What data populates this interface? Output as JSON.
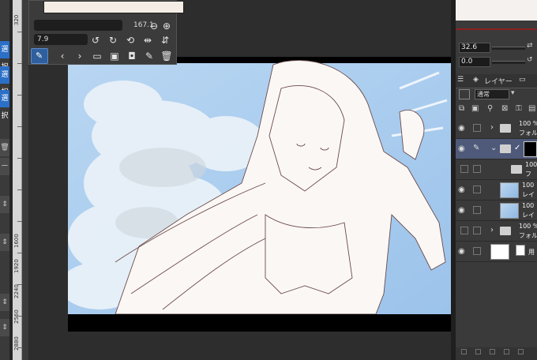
{
  "left_tabs": [
    "選択",
    "選択",
    "選択"
  ],
  "left_misc": {
    "label_a": "ー"
  },
  "ruler_marks": [
    "320",
    "1600",
    "1920",
    "2240",
    "2560",
    "2880"
  ],
  "navigator": {
    "zoom_value": "167.1",
    "rotate_value": "7.9",
    "icons": [
      "minus-icon",
      "plus-icon",
      "fit-icon",
      "rotate-left-icon",
      "rotate-right-icon",
      "reset-rotation-icon",
      "flip-horizontal-icon",
      "flip-vertical-icon",
      "eyedropper-icon",
      "prev-icon",
      "next-icon",
      "folder-open-icon",
      "new-image-icon",
      "camera-icon",
      "edit-icon",
      "trash-icon"
    ]
  },
  "right_panel": {
    "brush_size_value": "32.6",
    "opacity_value": "0.0",
    "layer_tab_label": "レイヤー",
    "blend_mode": "通常",
    "layers": [
      {
        "pct": "100 %",
        "name": "フォル",
        "kind": "folder",
        "selected": false
      },
      {
        "pct": "",
        "name": "",
        "kind": "folder-selected",
        "selected": true
      },
      {
        "pct": "100",
        "name": "フ",
        "kind": "folder",
        "selected": false
      },
      {
        "pct": "100",
        "name": "レイ",
        "kind": "raster",
        "selected": false
      },
      {
        "pct": "100",
        "name": "レイ",
        "kind": "raster",
        "selected": false
      },
      {
        "pct": "100 %",
        "name": "フォル",
        "kind": "folder",
        "selected": false
      },
      {
        "pct": "",
        "name": "用",
        "kind": "paper",
        "selected": false
      }
    ]
  },
  "colors": {
    "accent_blue": "#2b6fc7",
    "sky_blue": "#a9cbee",
    "selected_layer": "#4f5a7a"
  }
}
